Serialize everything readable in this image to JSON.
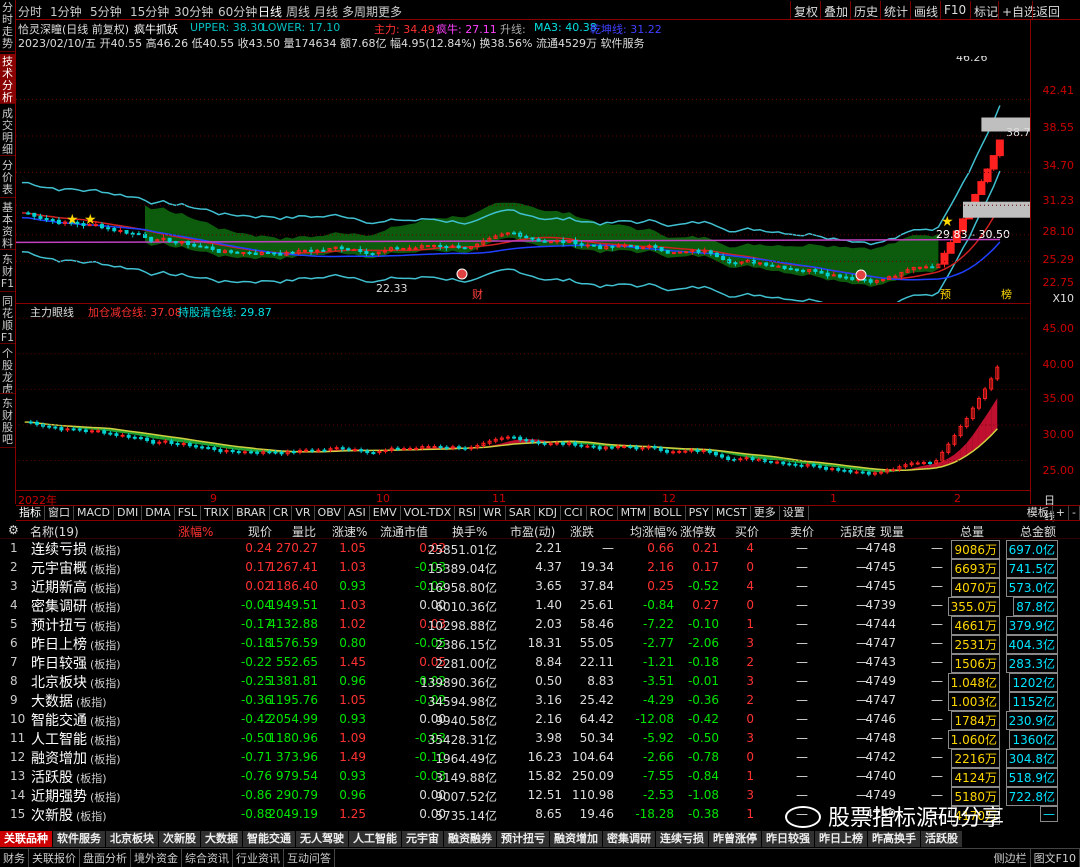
{
  "sidebar": [
    "分时走势",
    "技术分析",
    "成交明细",
    "分价表",
    "基本资料",
    "东财F10",
    "同花顺F10",
    "个股龙虎",
    "东财股吧"
  ],
  "periods": [
    "分时",
    "1分钟",
    "5分钟",
    "15分钟",
    "30分钟",
    "60分钟",
    "日线",
    "周线",
    "月线",
    "多周期",
    "更多"
  ],
  "toolbar": [
    "复权",
    "叠加",
    "历史",
    "统计",
    "画线",
    "F10",
    "标记",
    "+自选",
    "返回"
  ],
  "info": {
    "title": "恰灵深瞳(日线 前复权)",
    "indicator": "疯牛抓妖",
    "upper": "UPPER: 38.30",
    "lower": "LOWER: 17.10",
    "zhuli": "主力: 34.49",
    "fengniu": "疯牛: 27.11",
    "trend": "升线:",
    "ma3": "MA3: 40.38",
    "ppx": "乾坤线: 31.22",
    "bar": "2023/02/10/五 开40.55 高46.26 低40.55 收43.50 量174634 额7.68亿 幅4.95(12.84%) 换38.56% 流通4529万 软件服务"
  },
  "price_axis": [
    "42.41",
    "38.55",
    "34.70",
    "31.23",
    "28.10",
    "25.29",
    "22.75",
    "X10"
  ],
  "price_labels": {
    "high": "46.26",
    "low": "22.33",
    "range": "29.83 - 30.50",
    "last": "38.79",
    "cai": "财",
    "yu": "预",
    "bang": "榜"
  },
  "sub": {
    "name": "主力眼线",
    "l1": "加仓减仓线: 37.08",
    "l2": "持股清仓线: 29.87"
  },
  "sub_axis": [
    "45.00",
    "40.00",
    "35.00",
    "30.00",
    "25.00"
  ],
  "date_axis": {
    "year": "2022年",
    "m9": "9",
    "m10": "10",
    "m11": "11",
    "m12": "12",
    "m1": "1",
    "m2": "2",
    "period": "日线"
  },
  "tabs": [
    "指标",
    "窗口",
    "MACD",
    "DMI",
    "DMA",
    "FSL",
    "TRIX",
    "BRAR",
    "CR",
    "VR",
    "OBV",
    "ASI",
    "EMV",
    "VOL-TDX",
    "RSI",
    "WR",
    "SAR",
    "KDJ",
    "CCI",
    "ROC",
    "MTM",
    "BOLL",
    "PSY",
    "MCST",
    "更多",
    "设置"
  ],
  "tab_right": [
    "模板",
    "+",
    "-"
  ],
  "table": {
    "headers": [
      "名称(19)",
      "涨幅%",
      "现价",
      "量比",
      "涨速%",
      "流通市值",
      "换手%",
      "市盈(动)",
      "涨跌",
      "均涨幅%",
      "涨停数",
      "买价",
      "卖价",
      "活跃度",
      "现量",
      "总量",
      "总金额"
    ],
    "rows": [
      [
        "1",
        "连续亏损",
        "(板指)",
        "0.24",
        "270.27",
        "1.05",
        "0.02",
        "25851.01亿",
        "2.21",
        "—",
        "0.66",
        "0.21",
        "4",
        "—",
        "—",
        "4748",
        "—",
        "9086万",
        "697.0亿"
      ],
      [
        "2",
        "元宇宙概",
        "(板指)",
        "0.17",
        "1267.41",
        "1.03",
        "-0.03",
        "15389.04亿",
        "4.37",
        "19.34",
        "2.16",
        "0.17",
        "0",
        "—",
        "—",
        "4745",
        "—",
        "6693万",
        "741.5亿"
      ],
      [
        "3",
        "近期新高",
        "(板指)",
        "0.02",
        "1186.40",
        "0.93",
        "-0.02",
        "16958.80亿",
        "3.65",
        "37.84",
        "0.25",
        "-0.52",
        "4",
        "—",
        "—",
        "4745",
        "—",
        "4070万",
        "573.0亿"
      ],
      [
        "4",
        "密集调研",
        "(板指)",
        "-0.04",
        "1949.51",
        "1.03",
        "0.00",
        "6010.36亿",
        "1.40",
        "25.61",
        "-0.84",
        "0.27",
        "0",
        "—",
        "—",
        "4739",
        "—",
        "355.0万",
        "87.8亿"
      ],
      [
        "5",
        "预计扭亏",
        "(板指)",
        "-0.17",
        "4132.88",
        "1.02",
        "0.03",
        "10298.88亿",
        "2.03",
        "58.46",
        "-7.22",
        "-0.10",
        "1",
        "—",
        "—",
        "4744",
        "—",
        "4661万",
        "379.9亿"
      ],
      [
        "6",
        "昨日上榜",
        "(板指)",
        "-0.18",
        "1576.59",
        "0.80",
        "-0.05",
        "2386.15亿",
        "18.31",
        "55.05",
        "-2.77",
        "-2.06",
        "3",
        "—",
        "—",
        "4747",
        "—",
        "2531万",
        "404.3亿"
      ],
      [
        "7",
        "昨日较强",
        "(板指)",
        "-0.22",
        "552.65",
        "1.45",
        "0.05",
        "2281.00亿",
        "8.84",
        "22.11",
        "-1.21",
        "-0.18",
        "2",
        "—",
        "—",
        "4743",
        "—",
        "1506万",
        "283.3亿"
      ],
      [
        "8",
        "北京板块",
        "(板指)",
        "-0.25",
        "1381.81",
        "0.96",
        "-0.02",
        "139890.36亿",
        "0.50",
        "8.83",
        "-3.51",
        "-0.01",
        "3",
        "—",
        "—",
        "4749",
        "—",
        "1.048亿",
        "1202亿"
      ],
      [
        "9",
        "大数据",
        "(板指)",
        "-0.36",
        "1195.76",
        "1.05",
        "-0.02",
        "34594.98亿",
        "3.16",
        "25.42",
        "-4.29",
        "-0.36",
        "2",
        "—",
        "—",
        "4747",
        "—",
        "1.003亿",
        "1152亿"
      ],
      [
        "10",
        "智能交通",
        "(板指)",
        "-0.42",
        "2054.99",
        "0.93",
        "0.00",
        "9940.58亿",
        "2.16",
        "64.42",
        "-12.08",
        "-0.42",
        "0",
        "—",
        "—",
        "4746",
        "—",
        "1784万",
        "230.9亿"
      ],
      [
        "11",
        "人工智能",
        "(板指)",
        "-0.50",
        "1180.96",
        "1.09",
        "-0.03",
        "35428.31亿",
        "3.98",
        "50.34",
        "-5.92",
        "-0.50",
        "3",
        "—",
        "—",
        "4748",
        "—",
        "1.060亿",
        "1360亿"
      ],
      [
        "12",
        "融资增加",
        "(板指)",
        "-0.71",
        "373.96",
        "1.49",
        "-0.10",
        "1964.49亿",
        "16.23",
        "104.64",
        "-2.66",
        "-0.78",
        "0",
        "—",
        "—",
        "4742",
        "—",
        "2216万",
        "304.8亿"
      ],
      [
        "13",
        "活跃股",
        "(板指)",
        "-0.76",
        "979.54",
        "0.93",
        "-0.03",
        "3149.88亿",
        "15.82",
        "250.09",
        "-7.55",
        "-0.84",
        "1",
        "—",
        "—",
        "4740",
        "—",
        "4124万",
        "518.9亿"
      ],
      [
        "14",
        "近期强势",
        "(板指)",
        "-0.86",
        "290.79",
        "0.96",
        "0.00",
        "9007.52亿",
        "12.51",
        "110.98",
        "-2.53",
        "-1.08",
        "3",
        "—",
        "—",
        "4749",
        "—",
        "5180万",
        "722.8亿"
      ],
      [
        "15",
        "次新股",
        "(板指)",
        "-0.88",
        "2049.19",
        "1.25",
        "0.00",
        "5735.14亿",
        "8.65",
        "19.46",
        "-18.28",
        "-0.38",
        "1",
        "—",
        "—",
        "4749",
        "—",
        "4170万",
        "—"
      ]
    ]
  },
  "bottom_tabs": [
    "关联品种",
    "软件服务",
    "北京板块",
    "次新股",
    "大数据",
    "智能交通",
    "无人驾驶",
    "人工智能",
    "元宇宙",
    "融资融券",
    "预计扭亏",
    "融资增加",
    "密集调研",
    "连续亏损",
    "昨曾涨停",
    "昨日较强",
    "昨日上榜",
    "昨高换手",
    "活跃股"
  ],
  "status": [
    "财务",
    "关联报价",
    "盘面分析",
    "境外资金",
    "综合资讯",
    "行业资讯",
    "互动问答",
    "图文F10",
    "侧边栏"
  ],
  "watermark": "股票指标源码分享"
}
